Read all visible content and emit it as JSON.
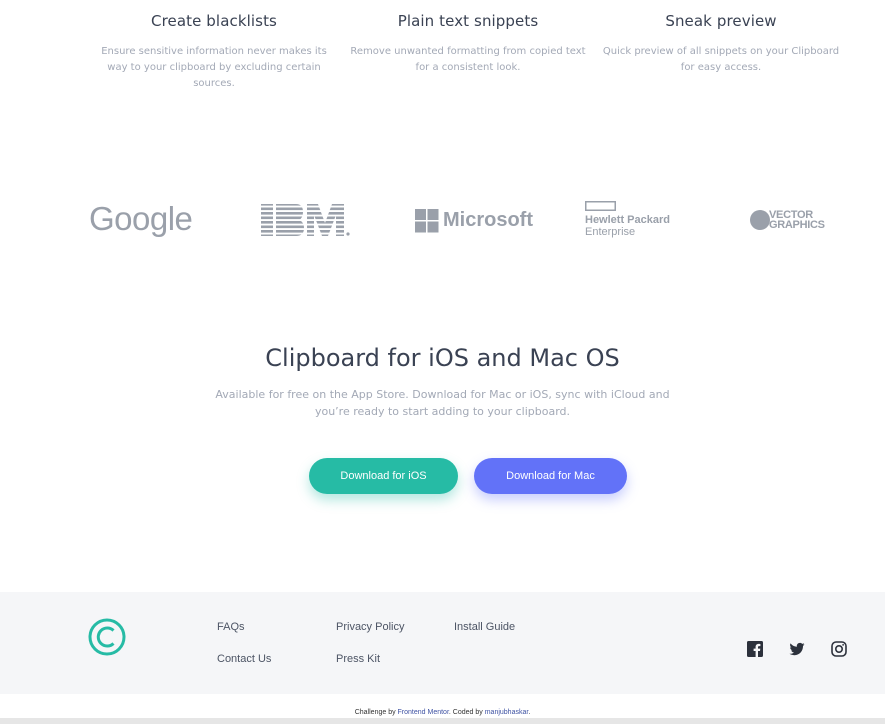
{
  "features": [
    {
      "title": "Create blacklists",
      "text": "Ensure sensitive information never makes its way to your clipboard by excluding certain sources."
    },
    {
      "title": "Plain text snippets",
      "text": "Remove unwanted formatting from copied text for a consistent look."
    },
    {
      "title": "Sneak preview",
      "text": "Quick preview of all snippets on your Clipboard for easy access."
    }
  ],
  "logos": {
    "google": "Google",
    "ibm": "IBM",
    "microsoft": "Microsoft",
    "hp_line1": "Hewlett Packard",
    "hp_line2": "Enterprise",
    "vector_line1": "VECTOR",
    "vector_line2": "GRAPHICS"
  },
  "cta": {
    "title": "Clipboard for iOS and Mac OS",
    "text": "Available for free on the App Store. Download for Mac or iOS, sync with iCloud and you’re ready to start adding to your clipboard.",
    "ios_label": "Download for iOS",
    "mac_label": "Download for Mac"
  },
  "footer": {
    "links": [
      "FAQs",
      "Contact Us",
      "Privacy Policy",
      "Press Kit",
      "Install Guide"
    ],
    "social_icons": [
      "facebook-icon",
      "twitter-icon",
      "instagram-icon"
    ]
  },
  "attribution": {
    "prefix": "Challenge by ",
    "mentor": "Frontend Mentor",
    "middle": ". Coded by ",
    "author": "manjubhaskar",
    "suffix": "."
  },
  "colors": {
    "accent_green": "#26bba5",
    "accent_blue": "#6272f8",
    "heading": "#3a4253",
    "muted": "#a3a9b6",
    "footer_bg": "#f5f6f8",
    "logo_gray": "#9aa0aa"
  }
}
